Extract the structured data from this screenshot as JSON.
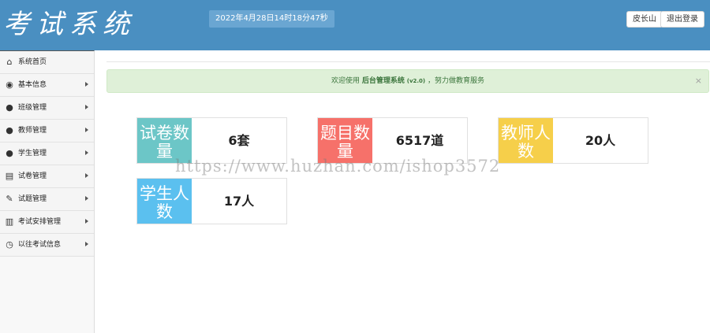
{
  "header": {
    "logo_text": "考试系统",
    "datetime": "2022年4月28日14时18分47秒",
    "user_button": "皮长山",
    "logout_button": "退出登录"
  },
  "sidebar": {
    "items": [
      {
        "label": "系统首页",
        "icon": "home-icon",
        "glyph": "⌂",
        "arrow": false
      },
      {
        "label": "基本信息",
        "icon": "disc-icon",
        "glyph": "◉",
        "arrow": true
      },
      {
        "label": "班级管理",
        "icon": "user-icon",
        "glyph": "●",
        "arrow": true
      },
      {
        "label": "教师管理",
        "icon": "user-icon",
        "glyph": "●",
        "arrow": true
      },
      {
        "label": "学生管理",
        "icon": "user-icon",
        "glyph": "●",
        "arrow": true
      },
      {
        "label": "试卷管理",
        "icon": "document-icon",
        "glyph": "▤",
        "arrow": true
      },
      {
        "label": "试题管理",
        "icon": "edit-icon",
        "glyph": "✎",
        "arrow": true
      },
      {
        "label": "考试安排管理",
        "icon": "books-icon",
        "glyph": "▥",
        "arrow": true
      },
      {
        "label": "以往考试信息",
        "icon": "clock-icon",
        "glyph": "◷",
        "arrow": true
      }
    ]
  },
  "welcome": {
    "prefix": "欢迎使用",
    "name": "后台管理系统",
    "version": "(v2.0)",
    "suffix": "，努力做教育服务",
    "close": "×"
  },
  "stats": [
    {
      "label": "试卷数量",
      "value": "6套",
      "color": "#6cc6c7"
    },
    {
      "label": "题目数量",
      "value": "6517道",
      "color": "#f6716a"
    },
    {
      "label": "教师人数",
      "value": "20人",
      "color": "#f6cf4a"
    },
    {
      "label": "学生人数",
      "value": "17人",
      "color": "#5bc0ef"
    }
  ],
  "watermark": "https://www.huzhan.com/ishop3572",
  "colors": {
    "header_bg": "#4a8fc1",
    "alert_bg": "#dff0d8",
    "alert_text": "#3c763d"
  }
}
